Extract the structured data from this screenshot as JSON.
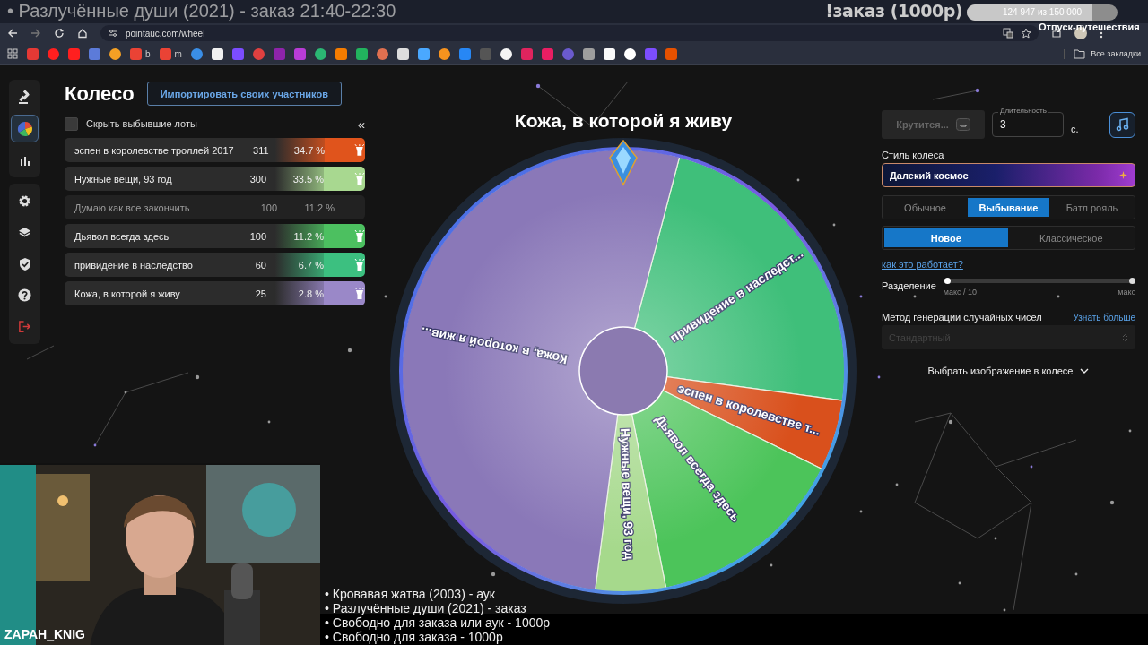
{
  "stream_overlay": {
    "title": "• Разлучённые души (2021) - заказ 21:40-22:30",
    "order_label": "!заказ (1000р)",
    "goal": {
      "text": "124 947  из 150 000",
      "level": 0.833
    },
    "subtitle": "Отпуск-путешествия",
    "streamer_name": "ZAPAH_KNIG",
    "schedule": [
      "• Кровавая жатва (2003) - аук",
      "• Разлучённые души (2021) - заказ",
      "• Свободно для заказа или аук - 1000р",
      "• Свободно для заказа - 1000р"
    ]
  },
  "browser": {
    "url": "pointauc.com/wheel",
    "bookmarks": [
      {
        "color": "#e53935"
      },
      {
        "color": "#ff1f1f"
      },
      {
        "color": "#ff1f1f"
      },
      {
        "color": "#5c7bd9"
      },
      {
        "color": "#f4a024"
      },
      {
        "color": "#ea4335",
        "label": "b"
      },
      {
        "color": "#ea4335",
        "label": "m"
      },
      {
        "color": "#3a8ee6"
      },
      {
        "color": "#f0f0f0"
      },
      {
        "color": "#7c4dff"
      },
      {
        "color": "#e04040"
      },
      {
        "color": "#8e24aa"
      },
      {
        "color": "#b83cd6"
      },
      {
        "color": "#2bb673"
      },
      {
        "color": "#f57c00"
      },
      {
        "color": "#22b35e"
      },
      {
        "color": "#e07050"
      },
      {
        "color": "#dddddd"
      },
      {
        "color": "#4aa8ff"
      },
      {
        "color": "#f7931e"
      },
      {
        "color": "#2787f5"
      },
      {
        "color": "#555555"
      },
      {
        "color": "#f5f5f5"
      },
      {
        "color": "#e0245e"
      },
      {
        "color": "#e91e63"
      },
      {
        "color": "#6a5acd"
      },
      {
        "color": "#9e9e9e"
      },
      {
        "color": "#fafafa"
      },
      {
        "color": "#ffffff"
      },
      {
        "color": "#7c4dff"
      },
      {
        "color": "#e65100"
      }
    ],
    "all_bookmarks": "Все закладки"
  },
  "sidebar": {
    "groups": [
      {
        "items": [
          {
            "kind": "gavel",
            "selected": false
          },
          {
            "kind": "pie",
            "selected": true
          },
          {
            "kind": "bars",
            "selected": false
          }
        ]
      },
      {
        "items": [
          {
            "kind": "gear",
            "selected": false
          },
          {
            "kind": "layers",
            "selected": false
          },
          {
            "kind": "shield",
            "selected": false
          },
          {
            "kind": "help",
            "selected": false
          },
          {
            "kind": "logout",
            "selected": false
          }
        ]
      }
    ]
  },
  "lots_panel": {
    "title": "Колесо",
    "import_button": "Импортировать своих участников",
    "hide_eliminated": {
      "label": "Скрыть выбывшие лоты",
      "checked": false
    },
    "collapse": "«",
    "lots": [
      {
        "name": "эспен в королевстве троллей 2017",
        "amount": "311",
        "percent": "34.7 %",
        "eliminated": false,
        "color": "#e0541c"
      },
      {
        "name": "Нужные вещи, 93 год",
        "amount": "300",
        "percent": "33.5 %",
        "eliminated": false,
        "color": "#a8d890"
      },
      {
        "name": "Думаю как все закончить",
        "amount": "100",
        "percent": "11.2 %",
        "eliminated": true
      },
      {
        "name": "Дьявол всегда здесь",
        "amount": "100",
        "percent": "11.2 %",
        "eliminated": false,
        "color": "#4cc060"
      },
      {
        "name": "привидение в наследство",
        "amount": "60",
        "percent": "6.7 %",
        "eliminated": false,
        "color": "#3cc080"
      },
      {
        "name": "Кожа, в которой я живу",
        "amount": "25",
        "percent": "2.8 %",
        "eliminated": false,
        "color": "#9a88c8"
      }
    ]
  },
  "wheel": {
    "title": "Кожа, в которой я живу",
    "slices": [
      {
        "label": "привидение в наследст...",
        "color": "#3fbf7a"
      },
      {
        "label": "эспен в королевстве т...",
        "color": "#d9501c"
      },
      {
        "label": "Дьявол всегда здесь",
        "color": "#4cc45a"
      },
      {
        "label": "Нужные вещи, 93 год",
        "color": "#a6d98c"
      },
      {
        "label": "Кожа, в которой я жив...",
        "color": "#8a78b8"
      }
    ]
  },
  "settings": {
    "spin_button": {
      "label": "Крутится...",
      "disabled": true
    },
    "duration": {
      "label": "Длительность",
      "value": "3",
      "unit": "с."
    },
    "style_label": "Стиль колеса",
    "style_value": "Далекий космос",
    "modes": [
      {
        "label": "Обычное",
        "selected": false
      },
      {
        "label": "Выбывание",
        "selected": true
      },
      {
        "label": "Батл рояль",
        "selected": false
      }
    ],
    "variants": [
      {
        "label": "Новое",
        "selected": true
      },
      {
        "label": "Классическое",
        "selected": false
      }
    ],
    "help_link": "как это работает?",
    "split": {
      "label": "Разделение",
      "level": 0.02,
      "min_label": "макс / 10",
      "max_label": "макс"
    },
    "rng": {
      "label": "Метод генерации случайных чисел",
      "link": "Узнать больше",
      "value": "Стандартный",
      "disabled": true
    },
    "image_picker": "Выбрать изображение в колесе"
  }
}
